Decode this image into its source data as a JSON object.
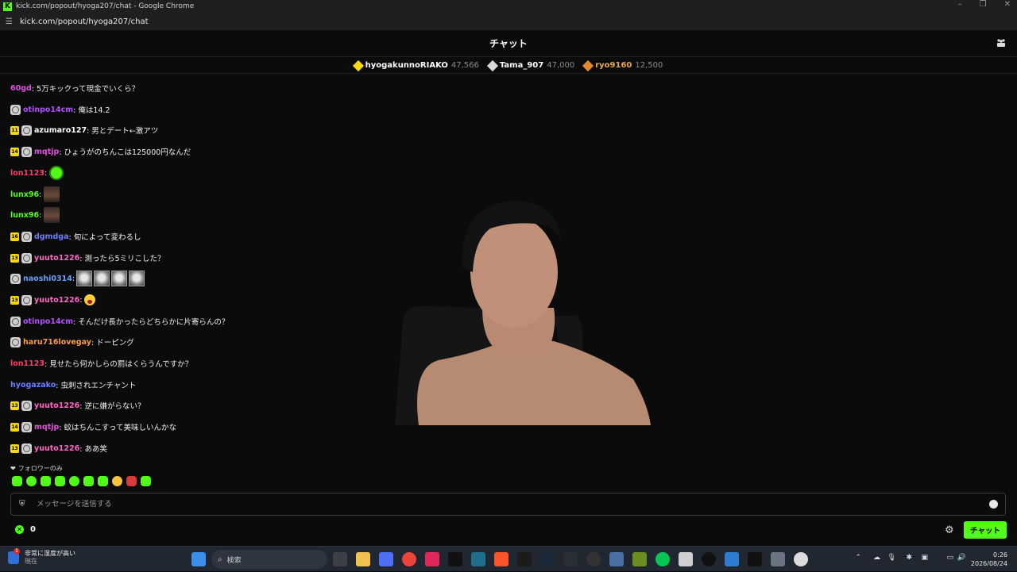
{
  "window": {
    "title": "kick.com/popout/hyoga207/chat - Google Chrome",
    "url": "kick.com/popout/hyoga207/chat"
  },
  "header": {
    "title": "チャット"
  },
  "leaderboard": [
    {
      "name": "hyogakunnoRIAKO",
      "count": "47,566",
      "color": "#f5d90a"
    },
    {
      "name": "Tama_907",
      "count": "47,000",
      "color": "#d9d9d9"
    },
    {
      "name": "ryo9160",
      "count": "12,500",
      "color": "#e08a2b"
    }
  ],
  "messages": [
    {
      "user": "60gd",
      "color": "#e24fdc",
      "text": ": 5万キックって現金でいくら？"
    },
    {
      "user": "otinpo14cm",
      "color": "#b44dff",
      "text": ": 俺は14.2"
    },
    {
      "user": "azumaro127",
      "color": "#ffffff",
      "text": ": 男とデート←激アツ",
      "sub": "11"
    },
    {
      "user": "mqtjp",
      "color": "#e24fdc",
      "text": ": ひょうがのちんこは125000円なんだ",
      "sub": "14"
    },
    {
      "user": "lon1123",
      "color": "#ff3b6b",
      "text": ":"
    },
    {
      "user": "lunx96",
      "color": "#53fc18",
      "text": ":"
    },
    {
      "user": "lunx96",
      "color": "#53fc18",
      "text": ":"
    },
    {
      "user": "dgmdga",
      "color": "#6b7dff",
      "text": ": 旬によって変わるし",
      "sub": "16"
    },
    {
      "user": "yuuto1226",
      "color": "#ff66c4",
      "text": ": 測ったら5ミリこした？",
      "sub": "13"
    },
    {
      "user": "naoshi0314",
      "color": "#6b9dff",
      "text": ":"
    },
    {
      "user": "yuuto1226",
      "color": "#ff66c4",
      "text": ":",
      "sub": "13"
    },
    {
      "user": "otinpo14cm",
      "color": "#b44dff",
      "text": ": そんだけ長かったらどちらかに片寄らんの？"
    },
    {
      "user": "haru716lovegay",
      "color": "#ff9b3b",
      "text": ": ドーピング"
    },
    {
      "user": "lon1123",
      "color": "#ff3b6b",
      "text": ": 見せたら何かしらの罰はくらうんですか？"
    },
    {
      "user": "hyogazako",
      "color": "#6b7dff",
      "text": ": 虫刺されエンチャント"
    },
    {
      "user": "yuuto1226",
      "color": "#ff66c4",
      "text": ": 逆に嫌がらない？",
      "sub": "13"
    },
    {
      "user": "mqtjp",
      "color": "#e24fdc",
      "text": ": 蚊はちんこすって美味しいんかな",
      "sub": "14"
    },
    {
      "user": "yuuto1226",
      "color": "#ff66c4",
      "text": ": ああ笑",
      "sub": "13"
    }
  ],
  "follower_only": "フォロワーのみ",
  "input": {
    "placeholder": "メッセージを送信する"
  },
  "points": {
    "value": "0"
  },
  "send_label": "チャット",
  "taskbar": {
    "weather_line1": "非常に湿度が高い",
    "weather_line2": "現在",
    "search_placeholder": "検索",
    "time": "0:26",
    "date": "2026/08/24"
  }
}
